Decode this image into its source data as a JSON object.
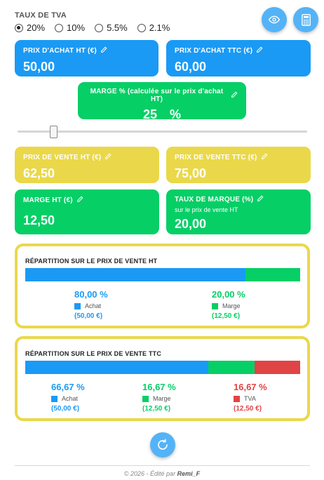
{
  "colors": {
    "blue": "#1a9af5",
    "green": "#06cf66",
    "yellow": "#ead84a",
    "red": "#e04444",
    "button": "#54b3f7"
  },
  "tva": {
    "title": "TAUX DE TVA",
    "options": [
      {
        "label": "20%",
        "checked": true
      },
      {
        "label": "10%",
        "checked": false
      },
      {
        "label": "5.5%",
        "checked": false
      },
      {
        "label": "2.1%",
        "checked": false
      }
    ]
  },
  "header_buttons": {
    "eye_icon": "eye-icon",
    "calculator_icon": "calculator-icon"
  },
  "cards": {
    "prix_achat_ht": {
      "label": "PRIX D'ACHAT HT (€)",
      "value": "50,00"
    },
    "prix_achat_ttc": {
      "label": "PRIX D'ACHAT TTC (€)",
      "value": "60,00"
    },
    "marge_pct": {
      "label": "MARGE % (calculée sur le prix d'achat HT)",
      "value": "25",
      "unit": "%"
    },
    "prix_vente_ht": {
      "label": "PRIX DE VENTE HT (€)",
      "value": "62,50"
    },
    "prix_vente_ttc": {
      "label": "PRIX DE VENTE TTC (€)",
      "value": "75,00"
    },
    "marge_ht": {
      "label": "MARGE HT (€)",
      "value": "12,50"
    },
    "taux_marque": {
      "label": "TAUX DE MARQUE (%)",
      "sub": "sur le prix de vente HT",
      "value": "20,00"
    }
  },
  "slider": {
    "value_pct": 25
  },
  "repartition_ht": {
    "title": "RÉPARTITION SUR LE PRIX DE VENTE HT",
    "items": [
      {
        "name": "Achat",
        "pct": "80,00 %",
        "amount": "(50,00 €)",
        "fraction": 0.8,
        "color": "#1a9af5"
      },
      {
        "name": "Marge",
        "pct": "20,00 %",
        "amount": "(12,50 €)",
        "fraction": 0.2,
        "color": "#06cf66"
      }
    ]
  },
  "repartition_ttc": {
    "title": "RÉPARTITION SUR LE PRIX DE VENTE TTC",
    "items": [
      {
        "name": "Achat",
        "pct": "66,67 %",
        "amount": "(50,00 €)",
        "fraction": 0.6667,
        "color": "#1a9af5"
      },
      {
        "name": "Marge",
        "pct": "16,67 %",
        "amount": "(12,50 €)",
        "fraction": 0.1667,
        "color": "#06cf66"
      },
      {
        "name": "TVA",
        "pct": "16,67 %",
        "amount": "(12,50 €)",
        "fraction": 0.1667,
        "color": "#e04444"
      }
    ]
  },
  "reset_icon": "refresh-icon",
  "footer": {
    "prefix": "© 2026 - Édité par",
    "author": "Remi_F"
  }
}
